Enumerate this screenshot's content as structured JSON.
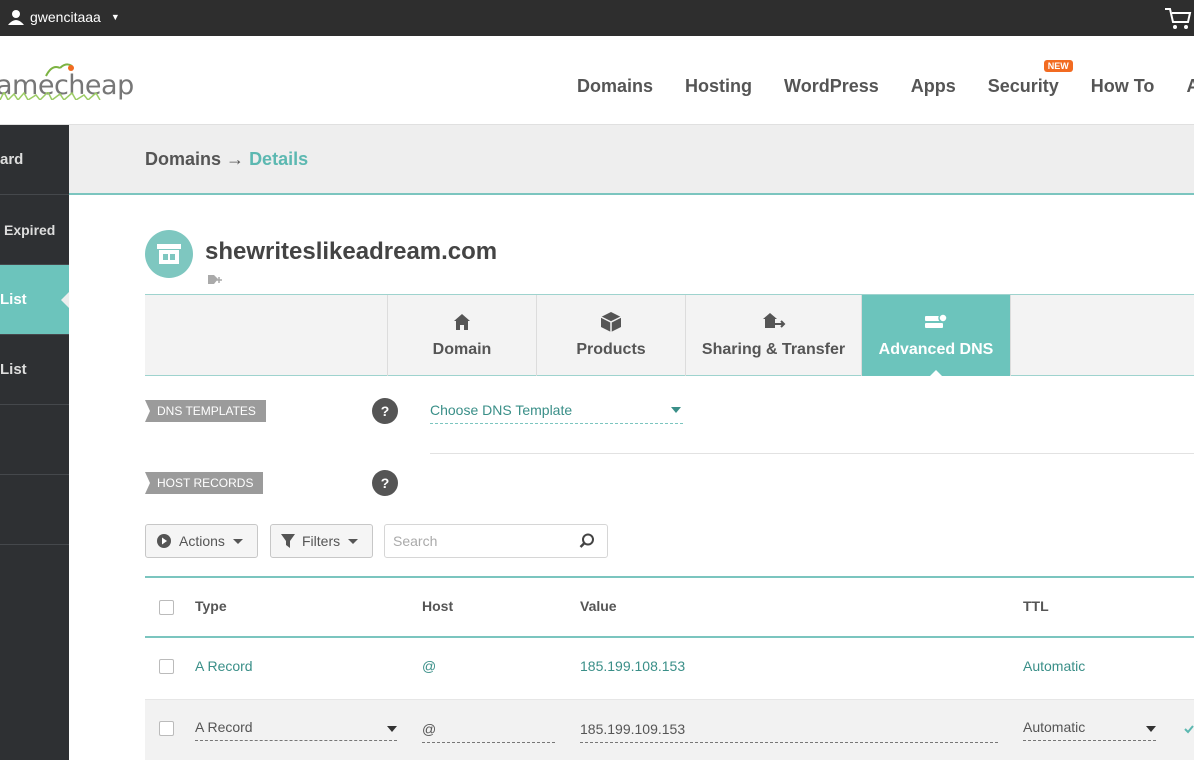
{
  "topbar": {
    "username": "gwencitaaa"
  },
  "logo": {
    "text": "amecheap"
  },
  "nav": [
    {
      "label": "Domains"
    },
    {
      "label": "Hosting"
    },
    {
      "label": "WordPress"
    },
    {
      "label": "Apps"
    },
    {
      "label": "Security",
      "badge": "NEW"
    },
    {
      "label": "How To"
    },
    {
      "label": "Ac"
    }
  ],
  "sidebar": {
    "items": [
      {
        "label": "ard"
      },
      {
        "label": "Expired"
      },
      {
        "label": "List"
      },
      {
        "label": "List"
      },
      {
        "label": ""
      },
      {
        "label": ""
      }
    ]
  },
  "breadcrumb": {
    "parent": "Domains",
    "sep": "→",
    "current": "Details"
  },
  "domain": {
    "name": "shewriteslikeadream.com"
  },
  "tabs": [
    {
      "label": "Domain",
      "icon": "home-icon"
    },
    {
      "label": "Products",
      "icon": "box-icon"
    },
    {
      "label": "Sharing & Transfer",
      "icon": "house-arrow-icon"
    },
    {
      "label": "Advanced DNS",
      "icon": "server-icon",
      "active": true
    }
  ],
  "dns_templates": {
    "label": "DNS TEMPLATES",
    "select": "Choose DNS Template"
  },
  "host_records": {
    "label": "HOST RECORDS"
  },
  "toolbar": {
    "actions": "Actions",
    "filters": "Filters",
    "search_placeholder": "Search"
  },
  "table": {
    "columns": [
      "Type",
      "Host",
      "Value",
      "TTL"
    ],
    "rows": [
      {
        "type": "A Record",
        "host": "@",
        "value": "185.199.108.153",
        "ttl": "Automatic"
      },
      {
        "type": "A Record",
        "host": "@",
        "value": "185.199.109.153",
        "ttl": "Automatic"
      }
    ]
  },
  "colors": {
    "teal": "#6cc4bc",
    "dark": "#2e3033",
    "orange": "#f26b21"
  }
}
